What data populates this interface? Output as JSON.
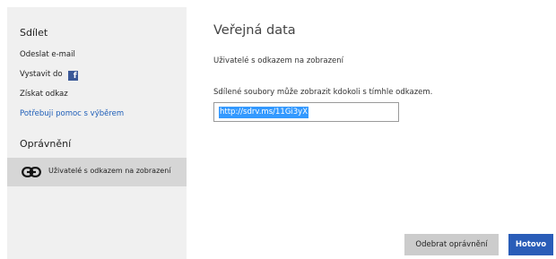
{
  "sidebar": {
    "share_heading": "Sdílet",
    "items": [
      {
        "label": "Odeslat e-mail"
      },
      {
        "label": "Vystavit do"
      },
      {
        "label": "Získat odkaz"
      },
      {
        "label": "Potřebuji pomoc s výběrem"
      }
    ],
    "permissions_heading": "Oprávnění",
    "permission_entry": "Uživatelé s odkazem na zobrazení",
    "facebook_glyph": "f"
  },
  "main": {
    "title": "Veřejná data",
    "subtitle": "Uživatelé s odkazem na zobrazení",
    "description": "Sdílené soubory může zobrazit kdokoli s tímhle odkazem.",
    "link_value": "http://sdrv.ms/11Gi3yX"
  },
  "buttons": {
    "revoke_label": "Odebrat oprávnění",
    "done_label": "Hotovo"
  },
  "colors": {
    "accent": "#2a5db8",
    "link": "#1e5eb8",
    "selection": "#3399ff",
    "facebook": "#3b5998"
  }
}
